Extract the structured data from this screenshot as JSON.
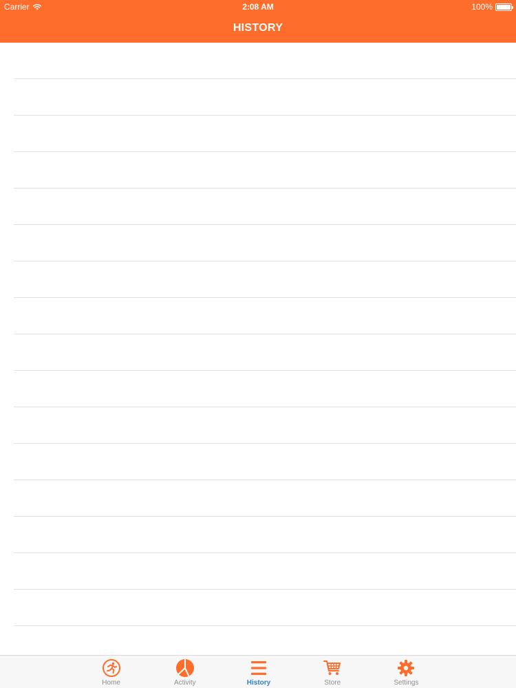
{
  "status_bar": {
    "carrier": "Carrier",
    "time": "2:08 AM",
    "battery": "100%",
    "battery_level": 1.0,
    "icons": {
      "wifi": "wifi-icon",
      "battery": "battery-icon"
    }
  },
  "nav": {
    "title": "HISTORY"
  },
  "colors": {
    "accent": "#ff6d2d",
    "tab_active_label": "#2f7fd1",
    "tab_inactive_label": "#8e8e8e",
    "separator": "#e1e1e1"
  },
  "tabs": [
    {
      "label": "Home",
      "icon": "running-person-icon",
      "active": false
    },
    {
      "label": "Activity",
      "icon": "pie-chart-icon",
      "active": false
    },
    {
      "label": "History",
      "icon": "list-icon",
      "active": true
    },
    {
      "label": "Store",
      "icon": "cart-icon",
      "active": false
    },
    {
      "label": "Settings",
      "icon": "gear-icon",
      "active": false
    }
  ]
}
